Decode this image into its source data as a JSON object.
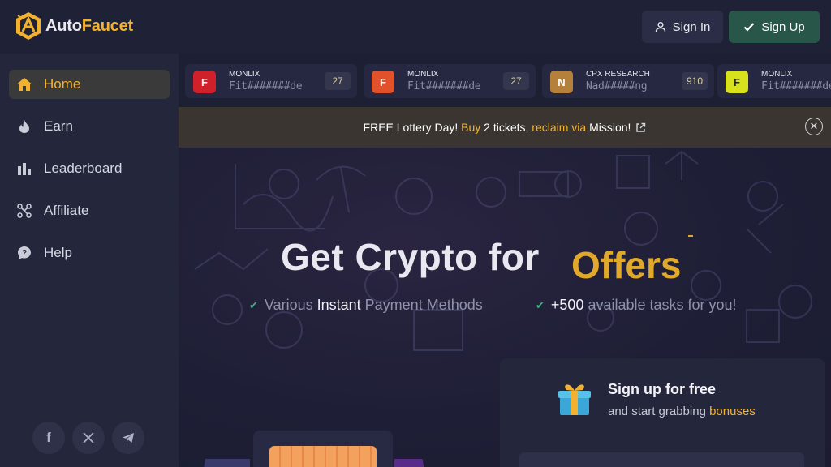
{
  "header": {
    "logo_part1": "Auto",
    "logo_part2": "Faucet",
    "signin_label": "Sign In",
    "signup_label": "Sign Up"
  },
  "sidebar": {
    "items": [
      {
        "label": "Home",
        "icon": "home-icon",
        "active": true
      },
      {
        "label": "Earn",
        "icon": "fire-icon",
        "active": false
      },
      {
        "label": "Leaderboard",
        "icon": "bar-chart-icon",
        "active": false
      },
      {
        "label": "Affiliate",
        "icon": "network-icon",
        "active": false
      },
      {
        "label": "Help",
        "icon": "help-icon",
        "active": false
      }
    ],
    "social": [
      "facebook-icon",
      "x-icon",
      "telegram-icon"
    ]
  },
  "ticker": [
    {
      "badge": "F",
      "badge_color": "#d0202a",
      "name": "MONLIX",
      "user": "Fit#######de",
      "count": "27"
    },
    {
      "badge": "F",
      "badge_color": "#e2522a",
      "name": "MONLIX",
      "user": "Fit#######de",
      "count": "27"
    },
    {
      "badge": "N",
      "badge_color": "#b5813a",
      "name": "CPX RESEARCH",
      "user": "Nad#####ng",
      "count": "910"
    },
    {
      "badge": "F",
      "badge_color": "#d7e21d",
      "name": "MONLIX",
      "user": "Fit#######de",
      "count": ""
    }
  ],
  "banner": {
    "t1": "FREE Lottery Day! ",
    "t2": "Buy",
    "t3": " 2 tickets, ",
    "t4": "reclaim via",
    "t5": " Mission!"
  },
  "hero": {
    "title": "Get Crypto for",
    "highlight": "Offers",
    "feature1_a": "Various ",
    "feature1_b": "Instant",
    "feature1_c": " Payment Methods",
    "feature2_a": "+500",
    "feature2_b": " available tasks for you!"
  },
  "signup_card": {
    "title": "Sign up for free",
    "sub_a": "and start grabbing ",
    "sub_b": "bonuses"
  },
  "colors": {
    "accent": "#f2b230",
    "signup_bg": "#28574a",
    "check": "#3fb27f"
  }
}
